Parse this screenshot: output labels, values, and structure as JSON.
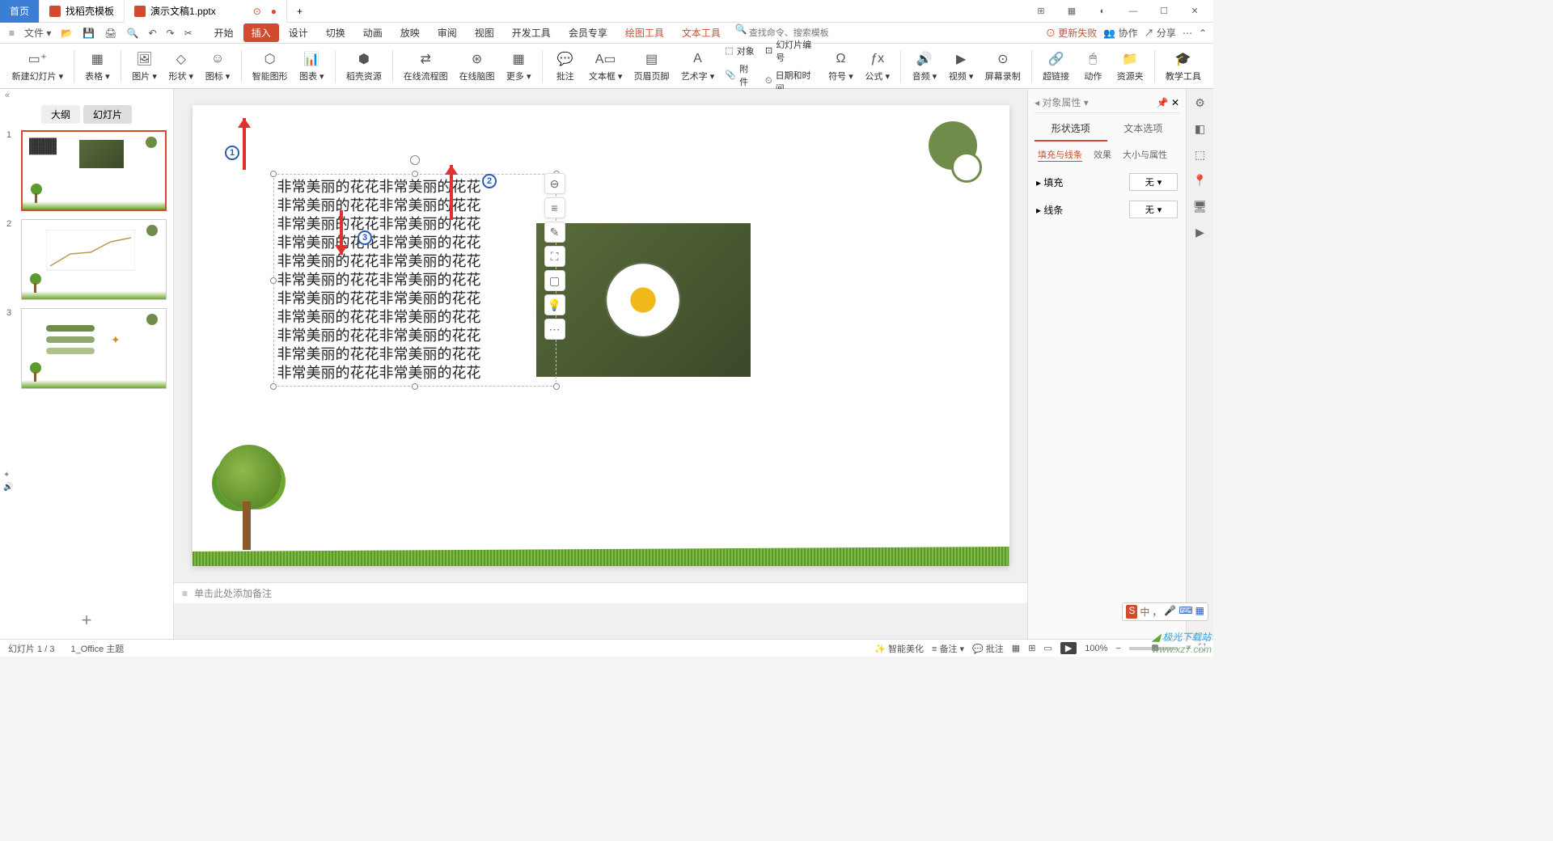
{
  "tabs": {
    "home": "首页",
    "template": "找稻壳模板",
    "doc": "演示文稿1.pptx",
    "add": "+"
  },
  "titlebar_right": {
    "update_fail": "更新失败"
  },
  "file_menu": "文件",
  "menu": {
    "start": "开始",
    "insert": "插入",
    "design": "设计",
    "transition": "切换",
    "animation": "动画",
    "slideshow": "放映",
    "review": "审阅",
    "view": "视图",
    "dev": "开发工具",
    "member": "会员专享",
    "draw": "绘图工具",
    "text": "文本工具"
  },
  "search_placeholder": "查找命令、搜索模板",
  "menu_right": {
    "update_fail": "更新失败",
    "collab": "协作",
    "share": "分享"
  },
  "ribbon": {
    "newslide": "新建幻灯片",
    "table": "表格",
    "picture": "图片",
    "shape": "形状",
    "icon": "图标",
    "smart": "智能图形",
    "chart": "图表",
    "dkres": "稻壳资源",
    "flowchart": "在线流程图",
    "mindmap": "在线脑图",
    "more": "更多",
    "comment": "批注",
    "textbox": "文本框",
    "headerfooter": "页眉页脚",
    "wordart": "艺术字",
    "object": "对象",
    "slidenum": "幻灯片编号",
    "attach": "附件",
    "datetime": "日期和时间",
    "symbol": "符号",
    "formula": "公式",
    "audio": "音频",
    "video": "视频",
    "screenrec": "屏幕录制",
    "hyperlink": "超链接",
    "action": "动作",
    "respkg": "资源夹",
    "teachtool": "教学工具"
  },
  "panel": {
    "outline": "大纲",
    "slides": "幻灯片"
  },
  "textbox_line": "非常美丽的花花非常美丽的花花",
  "prop": {
    "title": "对象属性",
    "shape_opts": "形状选项",
    "text_opts": "文本选项",
    "fill_line": "填充与线条",
    "effect": "效果",
    "size_prop": "大小与属性",
    "fill": "填充",
    "line": "线条",
    "none": "无"
  },
  "notes_placeholder": "单击此处添加备注",
  "status": {
    "slide_count": "幻灯片 1 / 3",
    "theme": "1_Office 主题",
    "beautify": "智能美化",
    "notes_btn": "备注",
    "comment_btn": "批注",
    "zoom": "100%"
  },
  "watermark": "极光下载站",
  "watermark_url": "www.xz7.com",
  "ime": {
    "zhong": "中",
    "items": [
      "，",
      "🎤",
      "⌨",
      "…"
    ]
  }
}
